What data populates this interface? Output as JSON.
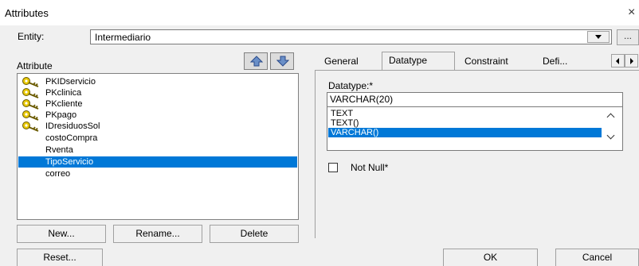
{
  "window": {
    "title": "Attributes",
    "close_glyph": "×"
  },
  "entity": {
    "label": "Entity:",
    "value": "Intermediario",
    "more_label": "..."
  },
  "attributes": {
    "label": "Attribute",
    "items": [
      {
        "name": "PKIDservicio",
        "key": true,
        "selected": false
      },
      {
        "name": "PKclinica",
        "key": true,
        "selected": false
      },
      {
        "name": "PKcliente",
        "key": true,
        "selected": false
      },
      {
        "name": "PKpago",
        "key": true,
        "selected": false
      },
      {
        "name": "IDresiduosSol",
        "key": true,
        "selected": false
      },
      {
        "name": "costoCompra",
        "key": false,
        "selected": false
      },
      {
        "name": "Rventa",
        "key": false,
        "selected": false
      },
      {
        "name": "TipoServicio",
        "key": false,
        "selected": true
      },
      {
        "name": "correo",
        "key": false,
        "selected": false
      }
    ]
  },
  "buttons": {
    "new": "New...",
    "rename": "Rename...",
    "delete": "Delete",
    "reset": "Reset...",
    "ok": "OK",
    "cancel": "Cancel"
  },
  "tabs": {
    "general": "General",
    "datatype": "Datatype",
    "constraint": "Constraint",
    "definition": "Defi...",
    "active": "datatype"
  },
  "datatype": {
    "label": "Datatype:*",
    "value": "VARCHAR(20)",
    "options": [
      "TEXT",
      "TEXT()",
      "VARCHAR()"
    ],
    "selected_option": "VARCHAR()"
  },
  "not_null": {
    "label": "Not Null*",
    "checked": false
  },
  "colors": {
    "selection": "#0078d7",
    "key_icon": "#e8c800"
  }
}
